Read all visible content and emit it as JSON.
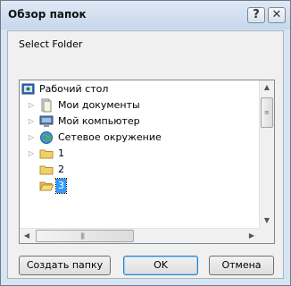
{
  "window": {
    "title": "Обзор папок",
    "help": "?",
    "close": "✕"
  },
  "description": "Select Folder",
  "tree": {
    "items": [
      {
        "label": "Рабочий стол",
        "icon": "desktop-icon",
        "expander": "",
        "selected": false
      },
      {
        "label": "Мои документы",
        "icon": "documents-icon",
        "expander": "▷",
        "selected": false
      },
      {
        "label": "Мой компьютер",
        "icon": "computer-icon",
        "expander": "▷",
        "selected": false
      },
      {
        "label": "Сетевое окружение",
        "icon": "network-icon",
        "expander": "▷",
        "selected": false
      },
      {
        "label": "1",
        "icon": "folder-icon",
        "expander": "▷",
        "selected": false
      },
      {
        "label": "2",
        "icon": "folder-icon",
        "expander": "",
        "selected": false
      },
      {
        "label": "3",
        "icon": "folder-open-icon",
        "expander": "",
        "selected": true
      }
    ]
  },
  "scroll": {
    "up": "▲",
    "down": "▼",
    "left": "◀",
    "right": "▶",
    "grip_v": "≡",
    "grip_h": "|||"
  },
  "buttons": {
    "new_folder": "Создать папку",
    "ok": "OK",
    "cancel": "Отмена"
  },
  "colors": {
    "selection": "#3399ff",
    "folder": "#f3cf6a",
    "title_bg": "#d7e4f2"
  }
}
